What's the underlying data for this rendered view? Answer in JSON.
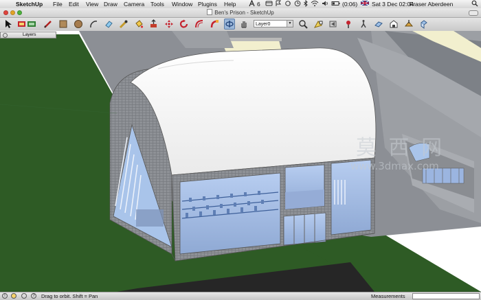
{
  "menubar": {
    "app_name": "SketchUp",
    "items": [
      "File",
      "Edit",
      "View",
      "Draw",
      "Camera",
      "Tools",
      "Window",
      "Plugins",
      "Help"
    ],
    "status_number": "6",
    "battery_text": "(0:06)",
    "datetime": "Sat 3 Dec  02:04",
    "user": "Fraser Aberdeen"
  },
  "window": {
    "title": "Ben's Prison - SketchUp"
  },
  "toolbar": {
    "layer_value": "Layer0"
  },
  "layers_panel": {
    "title": "Layers"
  },
  "status": {
    "hint": "Drag to orbit.  Shift = Pan",
    "measurements_label": "Measurements"
  },
  "watermark": {
    "cjk": "莫 西 网",
    "url": "www.3dmax.com"
  },
  "colors": {
    "grass": "#2e5b25",
    "sky": "#ffffff",
    "wall": "#8c8f95",
    "glass": "#a9c4ea",
    "roof": "#ffffff"
  }
}
